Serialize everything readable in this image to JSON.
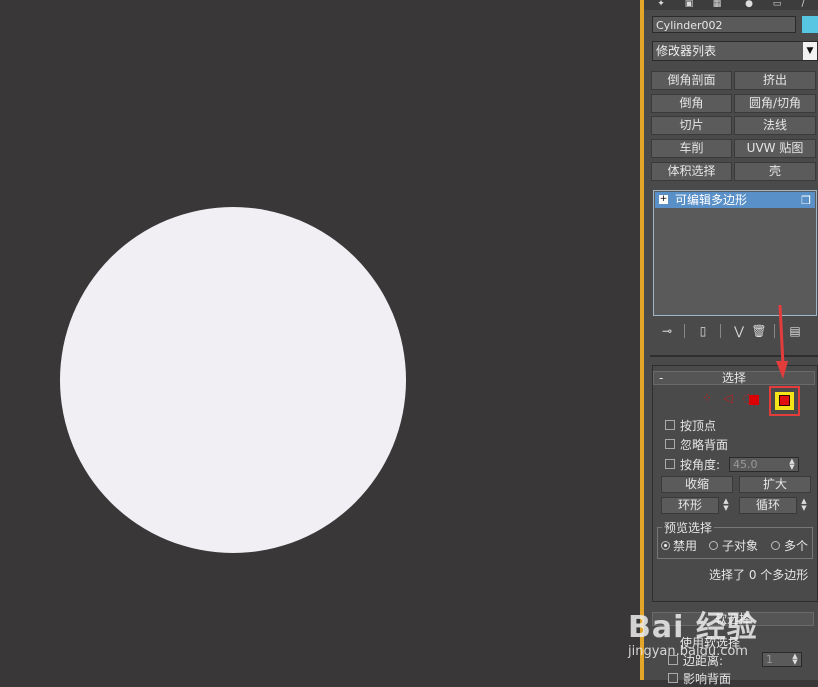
{
  "object_name": "Cylinder002",
  "object_color": "#57c6e2",
  "modifier_list": {
    "label": "修改器列表"
  },
  "modifier_buttons": [
    "倒角剖面",
    "挤出",
    "倒角",
    "圆角/切角",
    "切片",
    "法线",
    "车削",
    "UVW 贴图",
    "体积选择",
    "壳"
  ],
  "stack": {
    "item_label": "可编辑多边形",
    "expand": "+"
  },
  "selection": {
    "title": "选择",
    "collapse": "-",
    "by_vertex": "按顶点",
    "ignore_backfacing": "忽略背面",
    "by_angle": "按角度:",
    "angle_value": "45.0",
    "shrink": "收缩",
    "grow": "扩大",
    "ring": "环形",
    "loop": "循环",
    "preview_title": "预览选择",
    "preview_off": "禁用",
    "preview_sub": "子对象",
    "preview_multi": "多个",
    "status": "选择了 0 个多边形"
  },
  "soft_selection": {
    "title": "软选择",
    "use_soft": "使用软选择",
    "edge_distance": "边距离:",
    "edge_value": "1",
    "affect_backfacing": "影响背面"
  },
  "watermark": {
    "logo": "Bai 经验",
    "url": "jingyan.baidu.com"
  },
  "colors": {
    "viewport_bg": "#3a3739",
    "panel_bg": "#4a4a4a",
    "highlight": "#f5e418",
    "arrow": "#e23c3c"
  }
}
